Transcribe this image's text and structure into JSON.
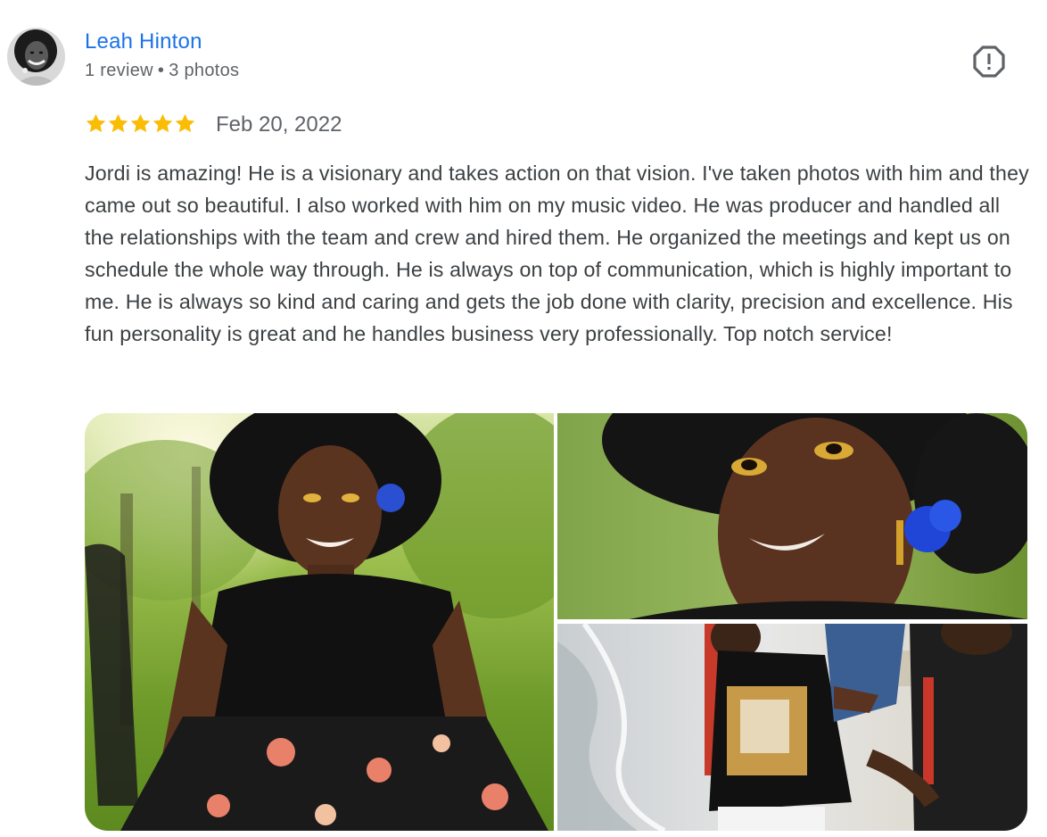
{
  "review": {
    "author": {
      "name": "Leah Hinton",
      "review_count": "1 review",
      "separator": "•",
      "photo_count": "3 photos",
      "avatar_icon": "user-avatar-photo"
    },
    "report_icon": "report-icon",
    "rating": {
      "value": 5,
      "max": 5,
      "star_color": "#fbbc04"
    },
    "date": "Feb 20, 2022",
    "text": "Jordi is amazing! He is a visionary and takes action on that vision. I've taken photos with him and they came out so beautiful. I also worked with him on my music video. He was producer and handled all the relationships with the team and crew and hired them. He organized the meetings and kept us on schedule the whole way through. He is always on top of communication, which is highly important to me. He is always so kind and caring and gets the job done with clarity, precision and excellence. His fun personality is great and he handles business very professionally. Top notch service!",
    "photos": [
      {
        "subject": "portrait-seated-park"
      },
      {
        "subject": "portrait-closeup-face"
      },
      {
        "subject": "beach-film-crew"
      }
    ]
  },
  "colors": {
    "link": "#1a73e8",
    "meta": "#5f6368",
    "body_text": "#3c4043"
  }
}
